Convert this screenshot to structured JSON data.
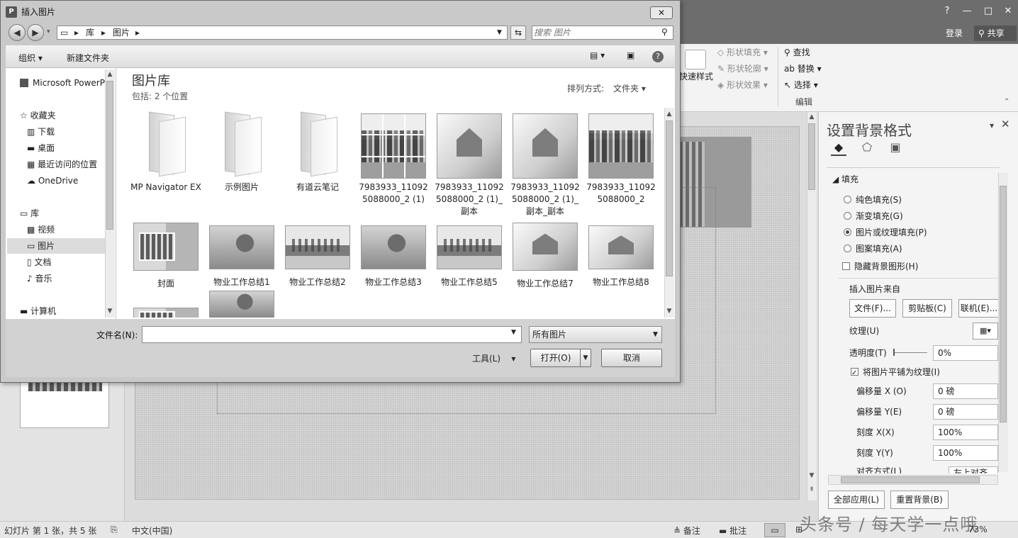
{
  "ppt": {
    "login": "登录",
    "share": "共享",
    "window_controls": [
      "?",
      "—",
      "□",
      "✕"
    ],
    "ribbon": {
      "quick_style": "快速样式",
      "shape_fill": "形状填充",
      "shape_outline": "形状轮廓",
      "shape_effect": "形状效果",
      "find": "查找",
      "replace": "替换",
      "select": "选择",
      "editing_group": "编辑"
    },
    "format_pane": {
      "title": "设置背景格式",
      "section_fill": "填充",
      "options": [
        "纯色填充(S)",
        "渐变填充(G)",
        "图片或纹理填充(P)",
        "图案填充(A)"
      ],
      "selected_option_index": 2,
      "hide_bg": "隐藏背景图形(H)",
      "insert_from": "插入图片来自",
      "btn_file": "文件(F)...",
      "btn_clipboard": "剪贴板(C)",
      "btn_online": "联机(E)...",
      "texture": "纹理(U)",
      "transparency": "透明度(T)",
      "transparency_value": "0%",
      "tile": "将图片平铺为纹理(I)",
      "offset_x": "偏移量 X (O)",
      "offset_x_value": "0 磅",
      "offset_y": "偏移量 Y(E)",
      "offset_y_value": "0 磅",
      "scale_x": "刻度 X(X)",
      "scale_x_value": "100%",
      "scale_y": "刻度 Y(Y)",
      "scale_y_value": "100%",
      "align": "对齐方式(L)",
      "align_value": "左上对齐",
      "apply_all": "全部应用(L)",
      "reset_bg": "重置背景(B)"
    },
    "status": {
      "slide_info": "幻灯片 第 1 张，共 5 张",
      "language": "中文(中国)",
      "notes": "备注",
      "comments": "批注",
      "zoom": "73%"
    },
    "watermark": "头条号 / 每天学一点哦"
  },
  "dialog": {
    "title": "插入图片",
    "close": "✕",
    "breadcrumb": [
      "库",
      "图片"
    ],
    "search_placeholder": "搜索 图片",
    "toolbar": {
      "organize": "组织 ▾",
      "new_folder": "新建文件夹"
    },
    "nav": {
      "top": "Microsoft PowerP",
      "favorites": "收藏夹",
      "fav_items": [
        "下载",
        "桌面",
        "最近访问的位置",
        "OneDrive"
      ],
      "library": "库",
      "lib_items": [
        "视频",
        "图片",
        "文档",
        "音乐"
      ],
      "computer": "计算机"
    },
    "library_title": "图片库",
    "library_sub": "包括:  2 个位置",
    "sort_label": "排列方式:",
    "sort_value": "文件夹 ▾",
    "items_row1": [
      {
        "label": "MP Navigator EX",
        "kind": "folder"
      },
      {
        "label": "示例图片",
        "kind": "folder"
      },
      {
        "label": "有道云笔记",
        "kind": "folder"
      },
      {
        "label": "7983933_110925088000_2 (1)",
        "kind": "city-grid"
      },
      {
        "label": "7983933_110925088000_2 (1)_副本",
        "kind": "house"
      },
      {
        "label": "7983933_110925088000_2 (1)_副本_副本",
        "kind": "house"
      },
      {
        "label": "7983933_110925088000_2",
        "kind": "city"
      }
    ],
    "items_row2": [
      {
        "label": "封面",
        "kind": "collage"
      },
      {
        "label": "物业工作总结1",
        "kind": "people"
      },
      {
        "label": "物业工作总结2",
        "kind": "sky"
      },
      {
        "label": "物业工作总结3",
        "kind": "people"
      },
      {
        "label": "物业工作总结5",
        "kind": "sky"
      },
      {
        "label": "物业工作总结7",
        "kind": "house"
      },
      {
        "label": "物业工作总结8",
        "kind": "house"
      }
    ],
    "filename_label": "文件名(N):",
    "filename_value": "",
    "filetype": "所有图片",
    "tools": "工具(L)",
    "open": "打开(O)",
    "cancel": "取消"
  }
}
